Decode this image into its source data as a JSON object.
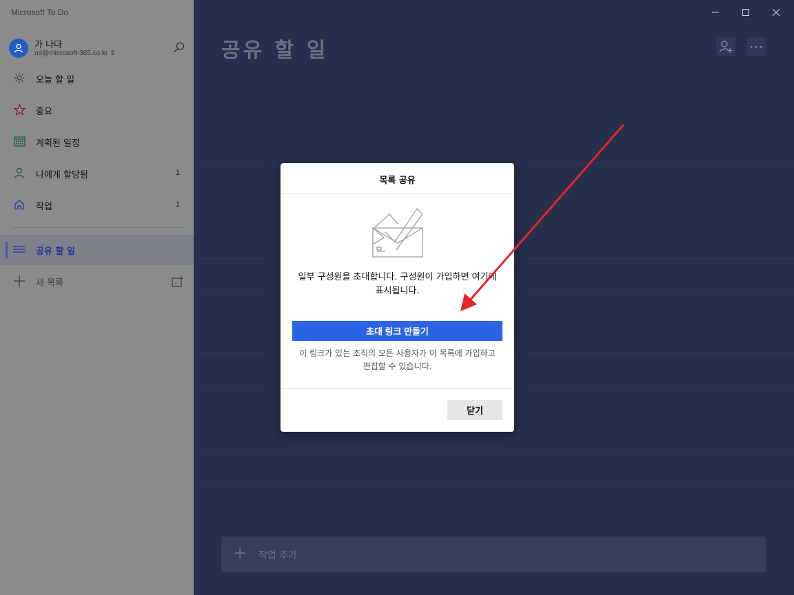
{
  "app": {
    "title": "Microsoft To Do"
  },
  "account": {
    "name": "가 나다",
    "email": "nd@microsoft-365.co.kr ⇕"
  },
  "sidebar": {
    "items": [
      {
        "label": "오늘 할 일",
        "icon": "sun-icon",
        "count": ""
      },
      {
        "label": "중요",
        "icon": "star-icon",
        "count": ""
      },
      {
        "label": "계획된 일정",
        "icon": "calendar-icon",
        "count": ""
      },
      {
        "label": "나에게 할당됨",
        "icon": "person-icon",
        "count": "1"
      },
      {
        "label": "작업",
        "icon": "home-icon",
        "count": "1"
      }
    ],
    "active_list": {
      "label": "공유 할 일",
      "icon": "list-icon"
    },
    "new_list": {
      "label": "새 목록",
      "icon": "plus-icon"
    }
  },
  "main": {
    "list_title": "공유 할 일",
    "add_task_label": "작업 추가"
  },
  "dialog": {
    "title": "목록 공유",
    "message": "일부 구성원을 초대합니다. 구성원이 가입하면 여기에 표시됩니다.",
    "invite_button": "초대 링크 만들기",
    "hint": "이 링크가 있는 조직의 모든 사용자가 이 목록에 가입하고 편집할 수 있습니다.",
    "close_button": "닫기"
  },
  "colors": {
    "accent": "#2c64e8",
    "annotation_arrow": "#e8232a"
  }
}
